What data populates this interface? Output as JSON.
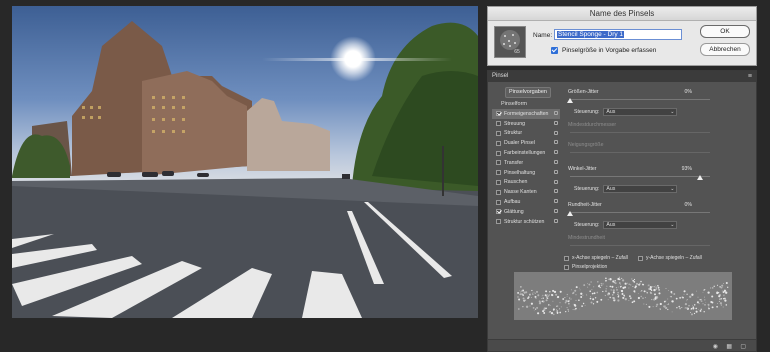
{
  "dialog": {
    "title": "Name des Pinsels",
    "thumb_size": "65",
    "name_label": "Name:",
    "name_value": "Stencil Sponge - Dry 1",
    "checkbox_label": "Pinselgröße in Vorgabe erfassen",
    "ok_label": "OK",
    "cancel_label": "Abbrechen"
  },
  "panel": {
    "title": "Pinsel",
    "menu_icon": "menu-icon",
    "presets_button": "Pinselvorgaben",
    "category": "Pinselform",
    "items": [
      {
        "label": "Formeigenschaften",
        "checked": true,
        "selected": true
      },
      {
        "label": "Streuung",
        "checked": false,
        "selected": false
      },
      {
        "label": "Struktur",
        "checked": false,
        "selected": false
      },
      {
        "label": "Dualer Pinsel",
        "checked": false,
        "selected": false
      },
      {
        "label": "Farbeinstellungen",
        "checked": false,
        "selected": false
      },
      {
        "label": "Transfer",
        "checked": false,
        "selected": false
      },
      {
        "label": "Pinselhaltung",
        "checked": false,
        "selected": false
      },
      {
        "label": "Rauschen",
        "checked": false,
        "selected": false
      },
      {
        "label": "Nasse Kanten",
        "checked": false,
        "selected": false
      },
      {
        "label": "Aufbau",
        "checked": false,
        "selected": false
      },
      {
        "label": "Glättung",
        "checked": true,
        "selected": false
      },
      {
        "label": "Struktur schützen",
        "checked": false,
        "selected": false
      }
    ],
    "size_jitter": {
      "label": "Größen-Jitter",
      "value": "0%",
      "level": 0
    },
    "control1": {
      "label": "Steuerung:",
      "value": "Aus"
    },
    "min_diameter": "Mindestdurchmesser",
    "tilt_scale": "Neigungsgröße",
    "angle_jitter": {
      "label": "Winkel-Jitter",
      "value": "93%",
      "level": 0.93
    },
    "control2": {
      "label": "Steuerung:",
      "value": "Aus"
    },
    "roundness_jitter": {
      "label": "Rundheit-Jitter",
      "value": "0%",
      "level": 0
    },
    "control3": {
      "label": "Steuerung:",
      "value": "Aus"
    },
    "min_roundness": "Mindestrundheit",
    "flip_x": "x-Achse spiegeln – Zufall",
    "flip_y": "y-Achse spiegeln – Zufall",
    "projection": "Pinselprojektion"
  },
  "colors": {
    "accent": "#2e6fd8",
    "panel_bg": "#535353",
    "dialog_bg": "#e8e8e8"
  }
}
